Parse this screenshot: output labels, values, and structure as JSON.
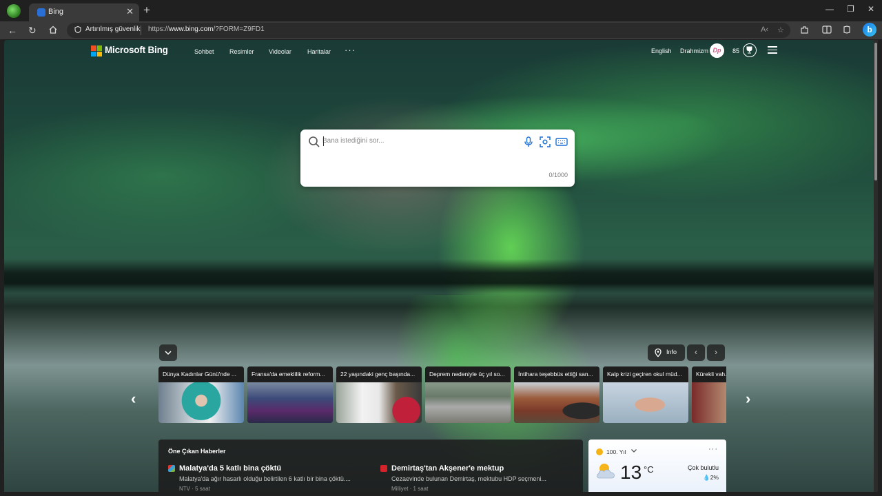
{
  "browser": {
    "tab_title": "Bing",
    "close_tab": "✕",
    "new_tab": "+",
    "window_controls": {
      "minimize": "—",
      "restore": "❐",
      "close": "✕"
    },
    "address": {
      "security_label": "Artırılmış güvenlik",
      "url_scheme": "https://",
      "url_host": "www.bing.com",
      "url_path": "/?FORM=Z9FD1",
      "read_aloud_icon": "A‹"
    }
  },
  "header": {
    "brand": "Microsoft Bing",
    "nav": [
      "Sohbet",
      "Resimler",
      "Videolar",
      "Haritalar"
    ],
    "more": "···",
    "language": "English",
    "user_name": "Drahmizm",
    "avatar_initials": "Dp",
    "points": "85"
  },
  "search": {
    "placeholder": "Bana istediğini sor...",
    "counter": "0/1000"
  },
  "carousel": {
    "info_label": "Info",
    "prev": "‹",
    "next": "›",
    "cards": [
      {
        "title": "Dünya Kadınlar Günü'nde ..."
      },
      {
        "title": "Fransa'da emeklilik reform..."
      },
      {
        "title": "22 yaşındaki genç başında..."
      },
      {
        "title": "Deprem nedeniyle üç yıl so..."
      },
      {
        "title": "İntihara teşebbüs ettiği san..."
      },
      {
        "title": "Kalp krizi geçiren okul müd..."
      },
      {
        "title": "Kürekli vah..."
      }
    ]
  },
  "news": {
    "heading": "Öne Çıkan Haberler",
    "items": [
      {
        "title": "Malatya'da 5 katlı bina çöktü",
        "description": "Malatya'da ağır hasarlı olduğu belirtilen 6 katlı bir bina çöktü....",
        "source": "NTV · 5 saat"
      },
      {
        "title": "Demirtaş'tan Akşener'e mektup",
        "description": "Cezaevinde bulunan Demirtaş, mektubu HDP seçmeni...",
        "source": "Milliyet · 1 saat"
      }
    ]
  },
  "weather": {
    "label": "100. Yıl",
    "more": "···",
    "temperature": "13",
    "unit": "°C",
    "condition": "Çok bulutlu",
    "precipitation": "💧2%"
  },
  "colors": {
    "ms_red": "#f25022",
    "ms_green": "#7fba00",
    "ms_blue": "#00a4ef",
    "ms_yellow": "#ffb900"
  }
}
